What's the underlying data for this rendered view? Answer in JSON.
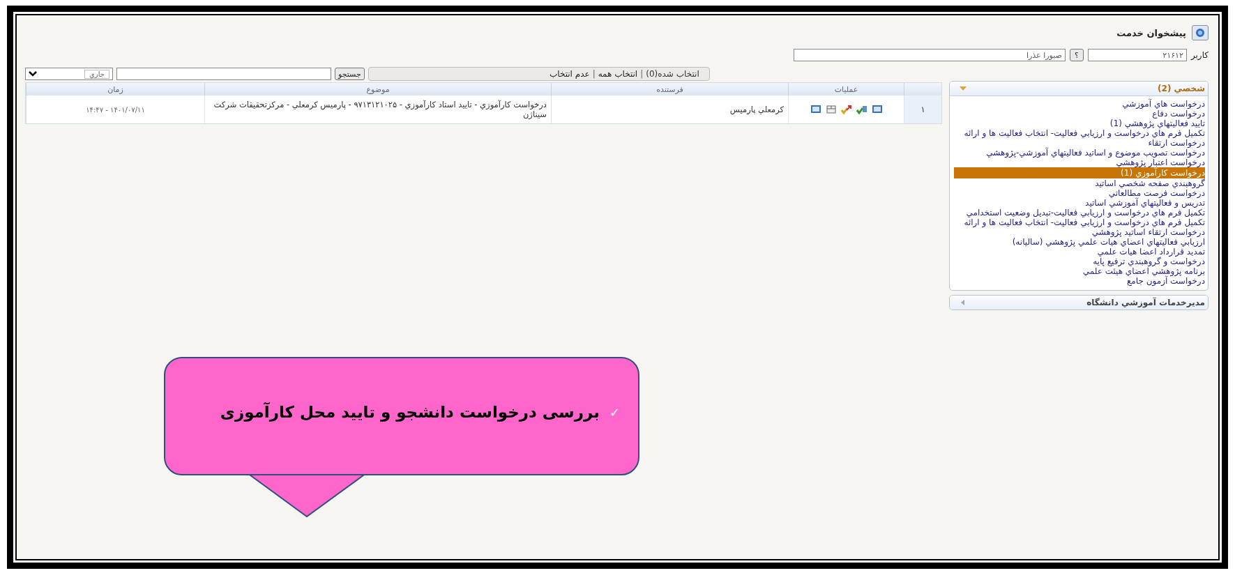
{
  "header": {
    "title": "پيشخوان خدمت"
  },
  "user": {
    "label": "كاربر",
    "code": "۲۱۶۱۲",
    "help": "؟",
    "name": "صبورا عذرا"
  },
  "toolbar": {
    "selection": [
      {
        "kind": "text",
        "label": "انتخاب شده(0)"
      },
      {
        "kind": "separator",
        "label": "|"
      },
      {
        "kind": "link",
        "label": "انتخاب همه"
      },
      {
        "kind": "separator",
        "label": "|"
      },
      {
        "kind": "link",
        "label": "عدم انتخاب"
      }
    ],
    "search_button": "جستجو",
    "filter": "جاري"
  },
  "table": {
    "columns": [
      "",
      "عمليات",
      "فرستنده",
      "موضوع",
      "زمان"
    ],
    "rows": [
      {
        "number": "۱",
        "actions": [
          {
            "kind": "monitor"
          },
          {
            "kind": "forward"
          },
          {
            "kind": "approve"
          },
          {
            "kind": "box"
          },
          {
            "kind": "monitor"
          }
        ],
        "sender": "كرمعلي پارميس",
        "subject": "درخواست كارآموزي - تاييد استاد كارآموزي - ۹۷۱۳۱۲۱۰۲۵ - پارميس كرمعلي - مركزتحقيقات شركت سيناژن",
        "time": "۱۴۰۱/۰۷/۱۱ - ۱۴:۴۷"
      }
    ]
  },
  "sidebar": {
    "sections": [
      {
        "title": "شخصي (2)",
        "expanded": true,
        "items": [
          {
            "label": "درخواست هاي آموزشي",
            "selected": false
          },
          {
            "label": "درخواست دفاع",
            "selected": false
          },
          {
            "label": "تاييد فعاليتهاي پژوهشي (1)",
            "selected": false
          },
          {
            "label": "تكميل فرم هاي درخواست و ارزيابي فعاليت- انتخاب فعاليت ها و ارائه درخواست ارتقاء",
            "selected": false
          },
          {
            "label": "درخواست تصويب موضوع و اساتيد فعاليتهاي آموزشي-پژوهشي",
            "selected": false
          },
          {
            "label": "درخواست اعتبار پژوهشي",
            "selected": false
          },
          {
            "label": "درخواست كارآموزي (1)",
            "selected": true
          },
          {
            "label": "گروهبندي صفحه شخصي اساتيد",
            "selected": false
          },
          {
            "label": "درخواست فرصت مطالعاتي",
            "selected": false
          },
          {
            "label": "تدريس و فعاليتهاي آموزشي اساتيد",
            "selected": false
          },
          {
            "label": "تكميل فرم هاي درخواست و ارزيابي فعاليت-تبديل وضعيت استخدامي",
            "selected": false
          },
          {
            "label": "تكميل فرم هاي درخواست و ارزيابي فعاليت- انتخاب فعاليت ها و ارائه درخواست ارتقاء اساتيد پژوهشي",
            "selected": false
          },
          {
            "label": "ارزيابي فعاليتهاي اعضاي هيات علمي پژوهشي (ساليانه)",
            "selected": false
          },
          {
            "label": "تمديد قرارداد اعضا هيات علمي",
            "selected": false
          },
          {
            "label": "درخواست و گروهبندي ترفيع پايه",
            "selected": false
          },
          {
            "label": "برنامه پژوهشي اعضاي هيئت علمي",
            "selected": false
          },
          {
            "label": "درخواست آزمون جامع",
            "selected": false
          }
        ]
      },
      {
        "title": "مديرخدمات آموزشي دانشگاه",
        "expanded": false
      }
    ]
  },
  "callout": {
    "mark": "✓",
    "text": "بررسی درخواست دانشجو و تایید محل کارآموزی"
  }
}
